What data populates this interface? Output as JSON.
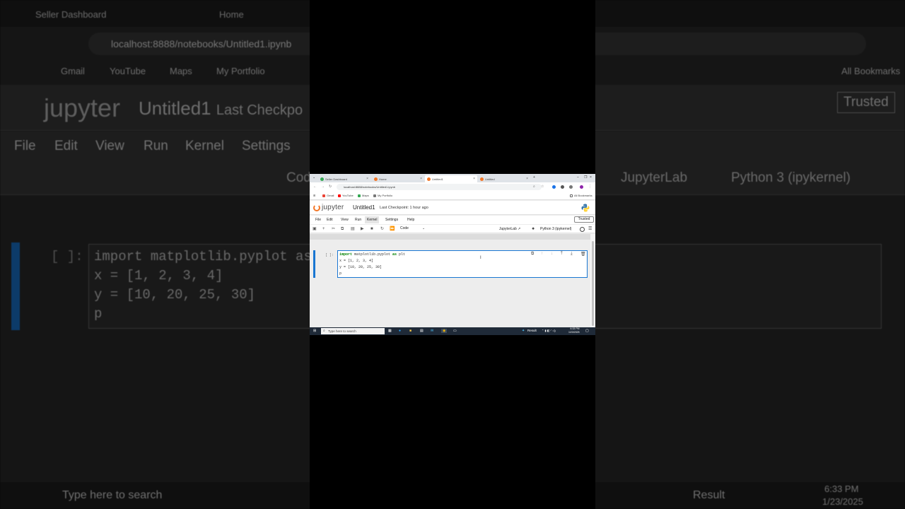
{
  "background": {
    "tabs": [
      "Seller Dashboard",
      "Home"
    ],
    "url": "localhost:8888/notebooks/Untitled1.ipynb",
    "bookmarks": [
      "Gmail",
      "YouTube",
      "Maps",
      "My Portfolio",
      "All Bookmarks"
    ],
    "logo": "jupyter",
    "title": "Untitled1",
    "checkpoint_partial": "Last Checkpo",
    "menu": [
      "File",
      "Edit",
      "View",
      "Run",
      "Kernel",
      "Settings"
    ],
    "trusted": "Trusted",
    "celltype_partial": "Cod",
    "jupyterlab": "JupyterLab",
    "kernel": "Python 3 (ipykernel)",
    "prompt": "[ ]:",
    "code": [
      "import matplotlib.pyplot as p",
      "x = [1, 2, 3, 4]",
      "y = [10, 20, 25, 30]",
      "p"
    ],
    "search": "Type here to search",
    "result": "Result",
    "time": "6:33 PM",
    "date": "1/23/2025"
  },
  "browser": {
    "tabs": [
      {
        "label": "Seller Dashboard",
        "color": "#34a853"
      },
      {
        "label": "Home",
        "color": "#f37626"
      },
      {
        "label": "Untitled1",
        "color": "#f37626"
      },
      {
        "label": "Untitled",
        "color": "#f37626"
      }
    ],
    "url": "localhost:8888/notebooks/Untitled1.ipynb",
    "bookmarks": [
      {
        "label": "Gmail",
        "color": "#ea4335"
      },
      {
        "label": "YouTube",
        "color": "#ff0000"
      },
      {
        "label": "Maps",
        "color": "#34a853"
      },
      {
        "label": "My Portfolio",
        "color": "#777777"
      }
    ],
    "all_bookmarks": "All Bookmarks"
  },
  "notebook": {
    "logo_text": "jupyter",
    "title": "Untitled1",
    "checkpoint": "Last Checkpoint: 1 hour ago",
    "menu": [
      "File",
      "Edit",
      "View",
      "Run",
      "Kernel",
      "Settings",
      "Help"
    ],
    "active_menu": "Kernel",
    "trusted": "Trusted",
    "cell_type": "Code",
    "jupyterlab": "JupyterLab",
    "kernel": "Python 3 (ipykernel)",
    "cell": {
      "prompt": "[ ]:",
      "lines": [
        {
          "kw": "import",
          "rest_a": " matplotlib.pyplot ",
          "kw2": "as",
          "rest_b": " plt"
        },
        {
          "text": "x = [1, 2, 3, 4]"
        },
        {
          "text": "y = [10, 20, 25, 30]"
        },
        {
          "text": "p"
        }
      ]
    }
  },
  "taskbar": {
    "search_placeholder": "Type here to search",
    "result": "Result",
    "time": "6:33 PM",
    "date": "1/23/2025"
  },
  "colors": {
    "accent": "#1976d2",
    "jupyter_orange": "#f37626",
    "taskbar": "#1f2a38"
  }
}
